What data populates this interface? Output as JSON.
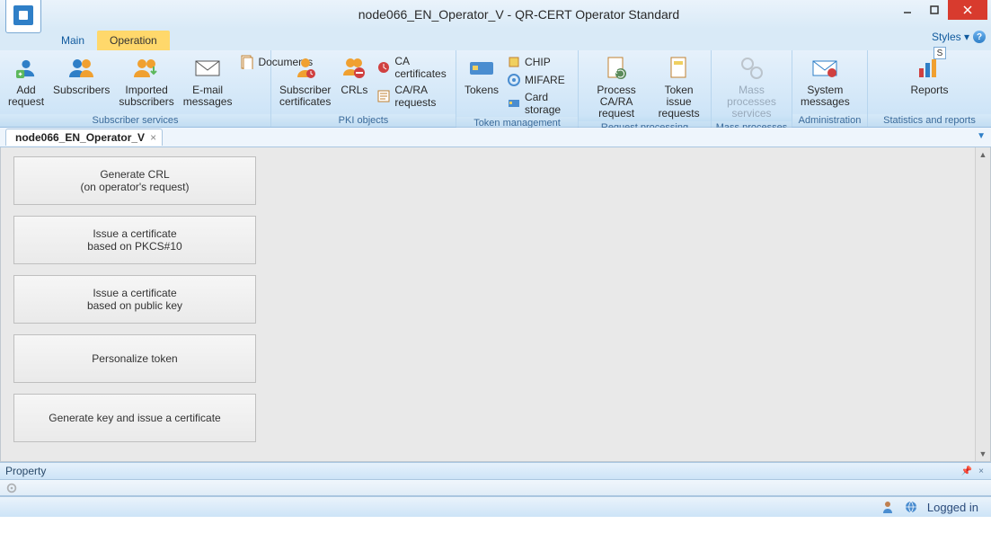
{
  "window": {
    "title": "node066_EN_Operator_V - QR-CERT Operator Standard"
  },
  "tabs": {
    "main": "Main",
    "operation": "Operation"
  },
  "tabbar": {
    "styles": "Styles",
    "s_hint": "S"
  },
  "ribbon": {
    "subscriber_services": {
      "label": "Subscriber services",
      "add_request": "Add\nrequest",
      "subscribers": "Subscribers",
      "imported_subscribers": "Imported\nsubscribers",
      "email_messages": "E-mail\nmessages",
      "documents": "Documents"
    },
    "pki_objects": {
      "label": "PKI objects",
      "subscriber_certificates": "Subscriber\ncertificates",
      "crls": "CRLs",
      "ca_certificates": "CA certificates",
      "ca_ra_requests": "CA/RA requests"
    },
    "token_management": {
      "label": "Token management",
      "tokens": "Tokens",
      "chip": "CHIP",
      "mifare": "MIFARE",
      "card_storage": "Card storage"
    },
    "request_processing": {
      "label": "Request processing",
      "process_ca_ra": "Process\nCA/RA request",
      "token_issue": "Token issue\nrequests"
    },
    "mass_processes": {
      "label": "Mass processes",
      "mass_processes_services": "Mass processes\nservices"
    },
    "administration": {
      "label": "Administration",
      "system_messages": "System\nmessages"
    },
    "statistics_reports": {
      "label": "Statistics and reports",
      "reports": "Reports"
    }
  },
  "document": {
    "tab_label": "node066_EN_Operator_V",
    "buttons": {
      "generate_crl_l1": "Generate CRL",
      "generate_crl_l2": "(on operator's request)",
      "issue_pkcs10_l1": "Issue a certificate",
      "issue_pkcs10_l2": "based on PKCS#10",
      "issue_pubkey_l1": "Issue a certificate",
      "issue_pubkey_l2": "based on public key",
      "personalize_token": "Personalize token",
      "gen_key_issue": "Generate key and issue a certificate"
    }
  },
  "property_panel": {
    "title": "Property"
  },
  "statusbar": {
    "logged_in": "Logged in"
  }
}
